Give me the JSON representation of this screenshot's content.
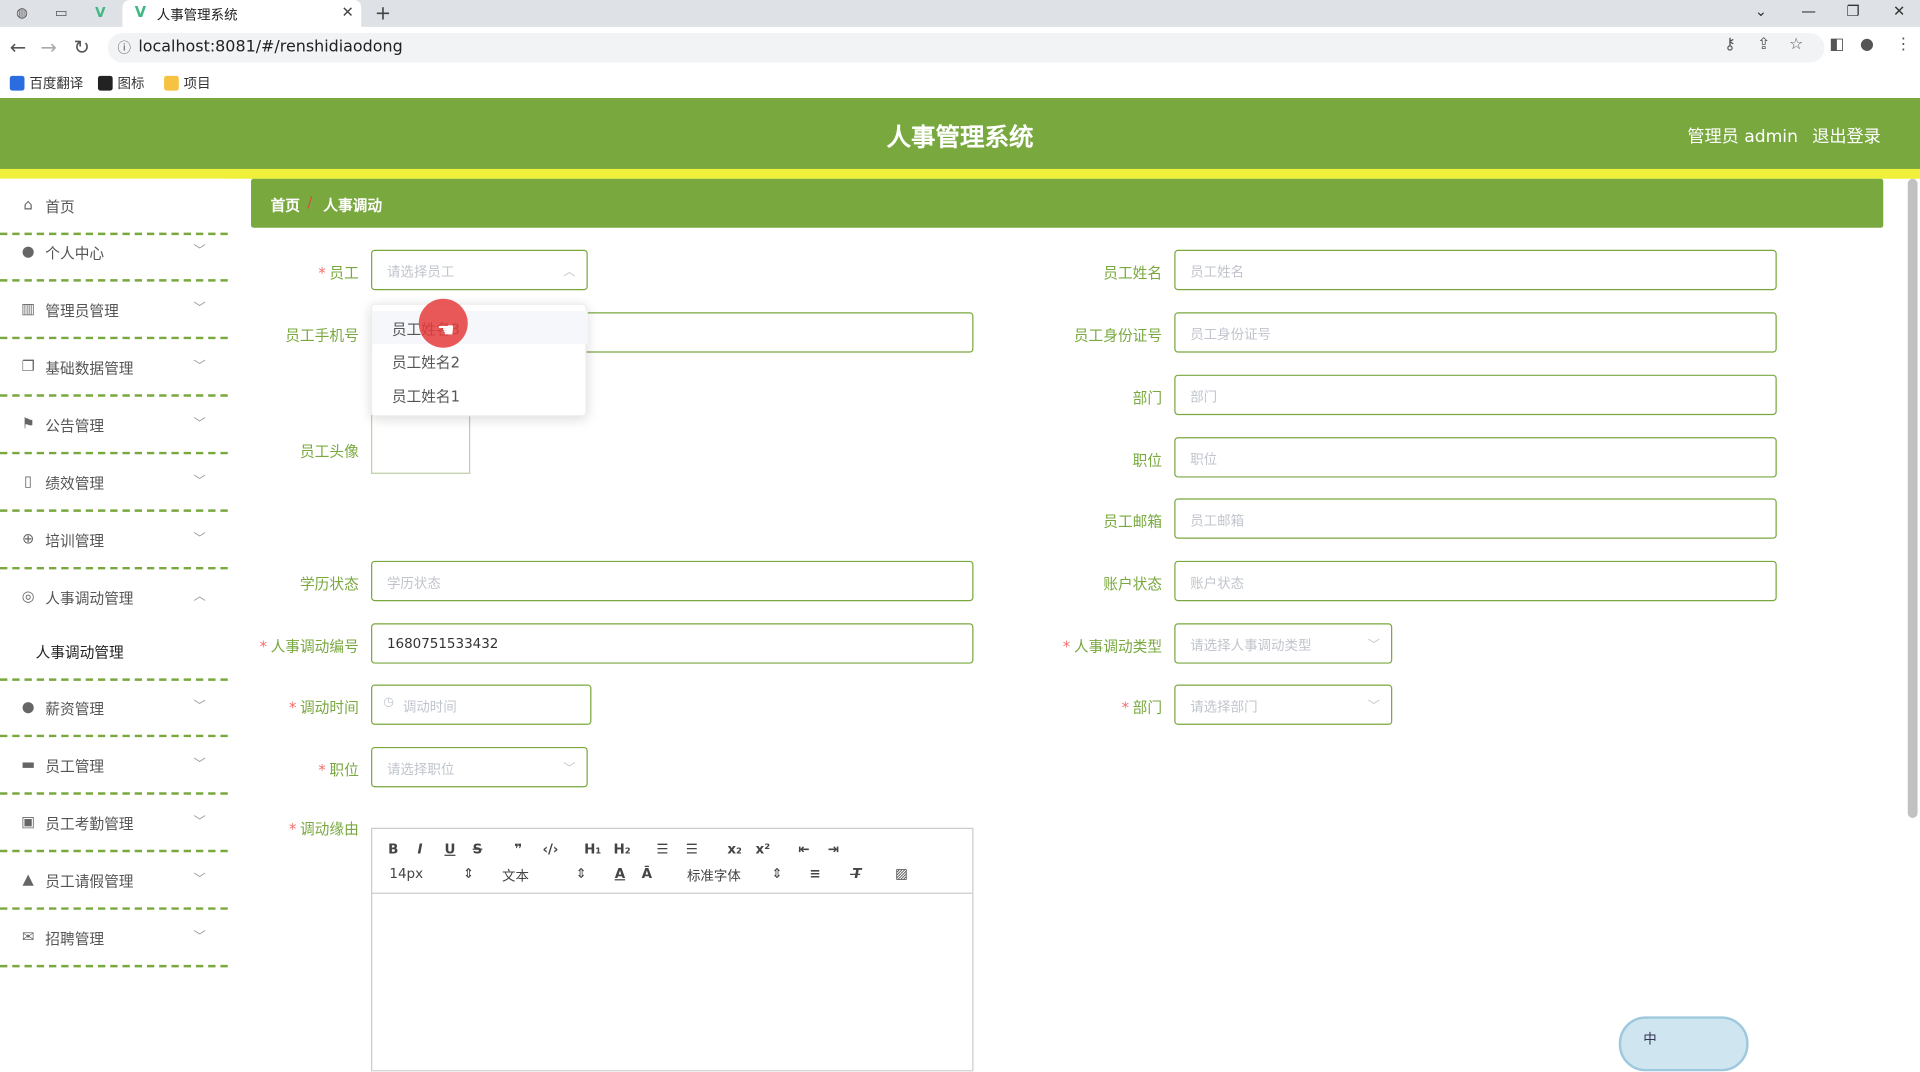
{
  "browser": {
    "tab_title": "人事管理系统",
    "tab_close": "✕",
    "new_tab": "+",
    "url": "localhost:8081/#/renshidiaodong",
    "bookmarks": [
      "百度翻译",
      "图标",
      "项目"
    ],
    "win_controls": [
      "⌄",
      "—",
      "❐",
      "✕"
    ]
  },
  "header": {
    "title": "人事管理系统",
    "user": "管理员 admin",
    "logout": "退出登录"
  },
  "sidebar": {
    "items": [
      {
        "label": "首页",
        "icon": "home-icon"
      },
      {
        "label": "个人中心",
        "icon": "user-icon"
      },
      {
        "label": "管理员管理",
        "icon": "chart-icon"
      },
      {
        "label": "基础数据管理",
        "icon": "copy-icon"
      },
      {
        "label": "公告管理",
        "icon": "flag-icon"
      },
      {
        "label": "绩效管理",
        "icon": "bottle-icon"
      },
      {
        "label": "培训管理",
        "icon": "globe-icon"
      },
      {
        "label": "人事调动管理",
        "icon": "circle-icon"
      },
      {
        "label": "薪资管理",
        "icon": "pin-icon"
      },
      {
        "label": "员工管理",
        "icon": "ticket-icon"
      },
      {
        "label": "员工考勤管理",
        "icon": "clipboard-icon"
      },
      {
        "label": "员工请假管理",
        "icon": "person-icon"
      },
      {
        "label": "招聘管理",
        "icon": "mail-icon"
      }
    ],
    "subitem": "人事调动管理"
  },
  "breadcrumb": {
    "home": "首页",
    "sep": "/",
    "current": "人事调动"
  },
  "form": {
    "employee_label": "员工",
    "employee_placeholder": "请选择员工",
    "phone_label": "员工手机号",
    "avatar_label": "员工头像",
    "education_label": "学历状态",
    "education_placeholder": "学历状态",
    "code_label": "人事调动编号",
    "code_value": "1680751533432",
    "time_label": "调动时间",
    "time_placeholder": "调动时间",
    "position_label": "职位",
    "position_placeholder": "请选择职位",
    "reason_label": "调动缘由",
    "name_label": "员工姓名",
    "name_placeholder": "员工姓名",
    "idcard_label": "员工身份证号",
    "idcard_placeholder": "员工身份证号",
    "dept_label": "部门",
    "dept_placeholder": "部门",
    "job_label": "职位",
    "job_placeholder": "职位",
    "email_label": "员工邮箱",
    "email_placeholder": "员工邮箱",
    "account_label": "账户状态",
    "account_placeholder": "账户状态",
    "type_label": "人事调动类型",
    "type_placeholder": "请选择人事调动类型",
    "dept2_label": "部门",
    "dept2_placeholder": "请选择部门",
    "required_mark": "*"
  },
  "dropdown": {
    "options": [
      "员工姓名3",
      "员工姓名2",
      "员工姓名1"
    ]
  },
  "editor": {
    "font_size": "14px",
    "format": "文本",
    "font": "标准字体"
  },
  "ime": {
    "label": "中"
  }
}
